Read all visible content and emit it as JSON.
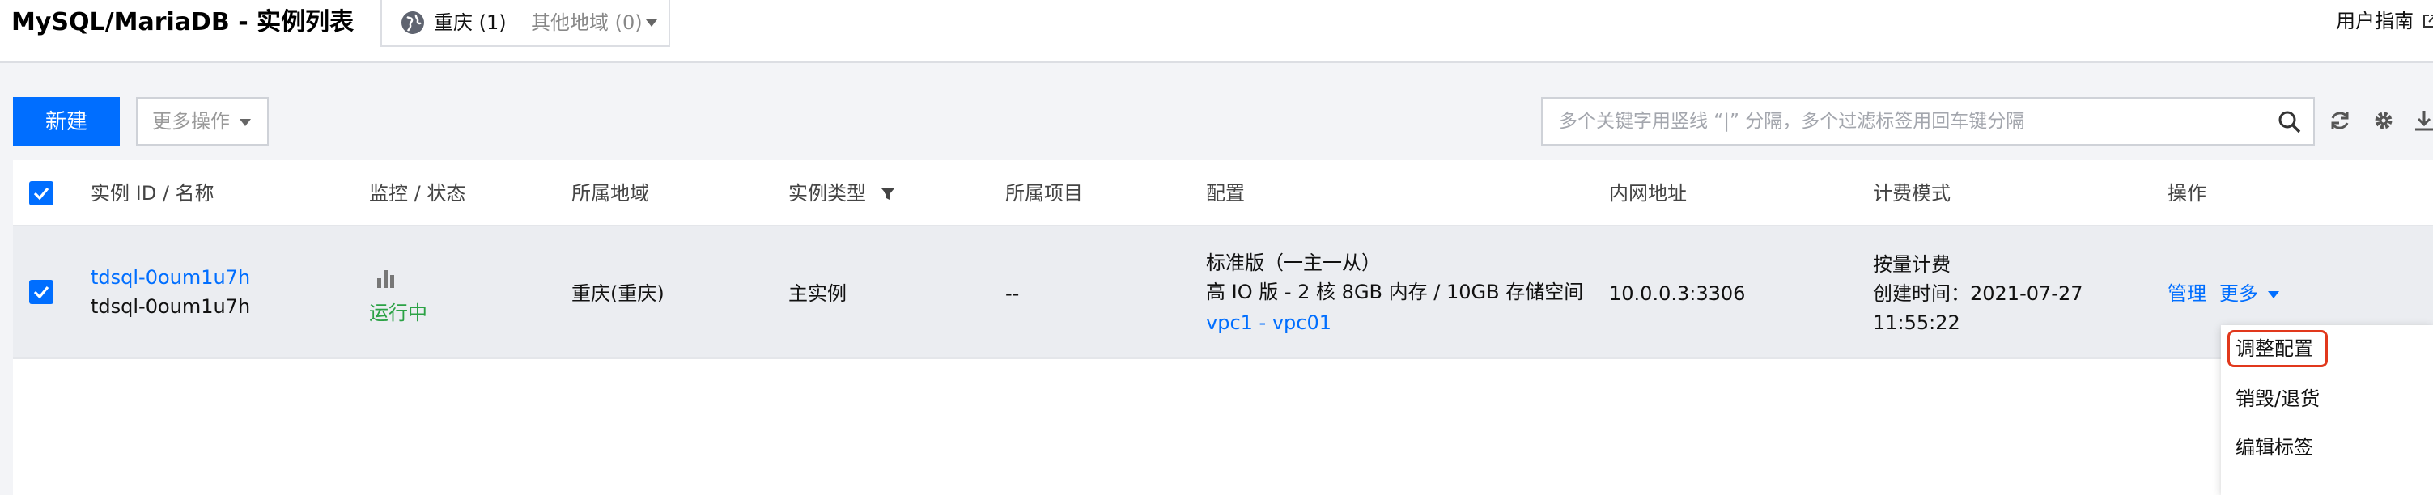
{
  "header": {
    "title": "MySQL/MariaDB - 实例列表",
    "region_current": "重庆 (1)",
    "region_other": "其他地域 (0)",
    "guide_label": "用户指南"
  },
  "toolbar": {
    "new_label": "新建",
    "more_ops_label": "更多操作",
    "search_placeholder": "多个关键字用竖线 “|” 分隔，多个过滤标签用回车键分隔"
  },
  "table": {
    "columns": [
      "实例 ID / 名称",
      "监控 / 状态",
      "所属地域",
      "实例类型",
      "所属项目",
      "配置",
      "内网地址",
      "计费模式",
      "操作"
    ],
    "rows": [
      {
        "id": "tdsql-0oum1u7h",
        "name": "tdsql-0oum1u7h",
        "status": "运行中",
        "region": "重庆(重庆)",
        "type": "主实例",
        "project": "--",
        "config_line1": "标准版（一主一从）",
        "config_line2": "高 IO 版 - 2 核 8GB 内存 / 10GB 存储空间",
        "vpc": "vpc1",
        "vpc_sep": " - ",
        "subnet": "vpc01",
        "address": "10.0.0.3:3306",
        "billing": "按量计费",
        "created_label": "创建时间：",
        "created_date": "2021-07-27",
        "created_time": "11:55:22",
        "op_manage": "管理",
        "op_more": "更多"
      }
    ]
  },
  "dropdown": {
    "items": [
      "调整配置",
      "销毁/退货",
      "编辑标签"
    ],
    "highlighted_index": 0
  },
  "colors": {
    "primary": "#006eff",
    "running": "#2ba245",
    "highlight_border": "#e1381c"
  }
}
